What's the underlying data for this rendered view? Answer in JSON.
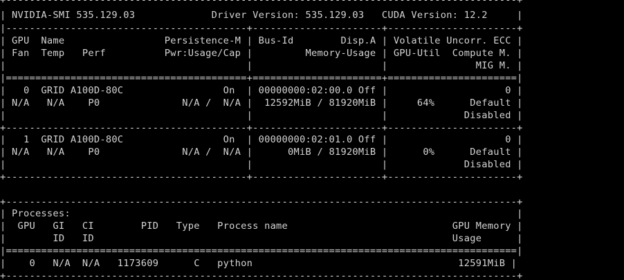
{
  "terminal": {
    "background": "#000000",
    "foreground": "#d4d4d4",
    "lines": [
      "+---------------------------------------------------------------------------------------+",
      "| NVIDIA-SMI 535.129.03             Driver Version: 535.129.03   CUDA Version: 12.2     |",
      "|-----------------------------------------+----------------------+----------------------+",
      "| GPU  Name                 Persistence-M | Bus-Id        Disp.A | Volatile Uncorr. ECC |",
      "| Fan  Temp   Perf          Pwr:Usage/Cap |         Memory-Usage | GPU-Util  Compute M. |",
      "|                                         |                      |               MIG M. |",
      "|=========================================+======================+======================|",
      "|   0  GRID A100D-80C                 On  | 00000000:02:00.0 Off |                    0 |",
      "| N/A   N/A    P0              N/A /  N/A |  12592MiB / 81920MiB |     64%      Default |",
      "|                                         |                      |             Disabled |",
      "+-----------------------------------------+----------------------+----------------------+",
      "|   1  GRID A100D-80C                 On  | 00000000:02:01.0 Off |                    0 |",
      "| N/A   N/A    P0              N/A /  N/A |      0MiB / 81920MiB |      0%      Default |",
      "|                                         |                      |             Disabled |",
      "+-----------------------------------------+----------------------+----------------------+",
      "",
      "+---------------------------------------------------------------------------------------+",
      "| Processes:                                                                            |",
      "|  GPU   GI   CI        PID   Type   Process name                            GPU Memory |",
      "|        ID   ID                                                             Usage      |",
      "|=======================================================================================|",
      "|    0   N/A  N/A   1173609      C   python                                   12591MiB |",
      "+---------------------------------------------------------------------------------------+"
    ]
  }
}
